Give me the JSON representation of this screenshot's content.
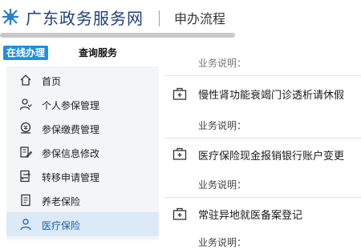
{
  "header": {
    "site_name": "广东政务服务网",
    "section": "申办流程"
  },
  "tabs": {
    "active": "在线办理",
    "other": "查询服务"
  },
  "sidebar": {
    "items": [
      {
        "label": "首页",
        "icon": "home-icon"
      },
      {
        "label": "个人参保管理",
        "icon": "person-icon"
      },
      {
        "label": "参保缴费管理",
        "icon": "payment-icon"
      },
      {
        "label": "参保信息修改",
        "icon": "edit-icon"
      },
      {
        "label": "转移申请管理",
        "icon": "transfer-icon"
      },
      {
        "label": "养老保险",
        "icon": "document-icon"
      },
      {
        "label": "医疗保险",
        "icon": "person-icon"
      }
    ],
    "active_index": 6
  },
  "services": {
    "partial_top": "业务说明：",
    "items": [
      {
        "title": "慢性肾功能衰竭门诊透析请休假",
        "desc": "业务说明："
      },
      {
        "title": "医疗保险现金报销银行账户变更",
        "desc": "业务说明："
      },
      {
        "title": "常驻异地就医备案登记",
        "desc": "业务说明："
      }
    ]
  }
}
